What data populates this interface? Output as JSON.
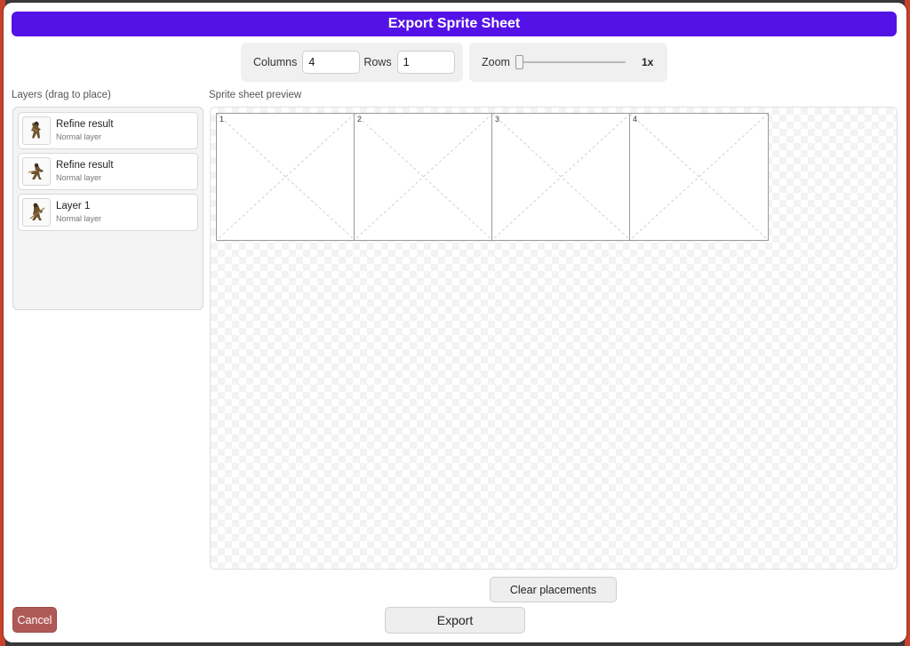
{
  "dialog": {
    "title": "Export Sprite Sheet"
  },
  "grid": {
    "columns_label": "Columns",
    "columns_value": "4",
    "rows_label": "Rows",
    "rows_value": "1"
  },
  "zoom": {
    "label": "Zoom",
    "value": "1x",
    "level": 1
  },
  "layers_panel": {
    "label": "Layers (drag to place)",
    "items": [
      {
        "name": "Refine result",
        "type": "Normal layer"
      },
      {
        "name": "Refine result",
        "type": "Normal layer"
      },
      {
        "name": "Layer 1",
        "type": "Normal layer"
      }
    ]
  },
  "preview": {
    "label": "Sprite sheet preview",
    "cells": [
      "1",
      "2",
      "3",
      "4"
    ]
  },
  "actions": {
    "clear_label": "Clear placements",
    "export_label": "Export",
    "cancel_label": "Cancel"
  },
  "colors": {
    "title_bar": "#5512e6",
    "cancel": "#b05a57"
  },
  "icons": {
    "layer_thumb": "sprite-thumbnail-icon",
    "empty_cell": "empty-cell-cross-icon"
  }
}
